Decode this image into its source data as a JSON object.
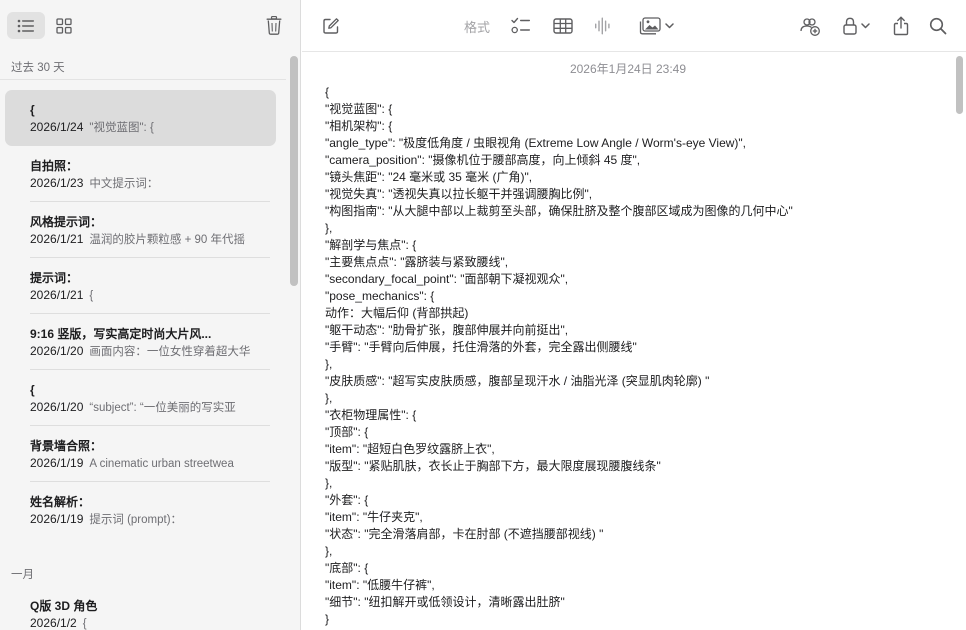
{
  "sidebar": {
    "sections": [
      {
        "label": "过去 30 天"
      },
      {
        "label": "一月"
      }
    ],
    "notes": [
      {
        "title": "{",
        "date": "2026/1/24",
        "preview": "\"视觉蓝图\": {"
      },
      {
        "title": "自拍照：",
        "date": "2026/1/23",
        "preview": "中文提示词："
      },
      {
        "title": "风格提示词：",
        "date": "2026/1/21",
        "preview": "温润的胶片颗粒感 + 90 年代摇"
      },
      {
        "title": "提示词：",
        "date": "2026/1/21",
        "preview": "{"
      },
      {
        "title": "9:16 竖版，写实高定时尚大片风...",
        "date": "2026/1/20",
        "preview": "画面内容：一位女性穿着超大华"
      },
      {
        "title": "{",
        "date": "2026/1/20",
        "preview": "“subject”: “一位美丽的写实亚"
      },
      {
        "title": "背景墙合照：",
        "date": "2026/1/19",
        "preview": "A cinematic urban streetwea"
      },
      {
        "title": "姓名解析：",
        "date": "2026/1/19",
        "preview": "提示词 (prompt)："
      },
      {
        "title": "Q版 3D 角色",
        "date": "2026/1/2",
        "preview": "{"
      }
    ]
  },
  "toolbar": {
    "format_label": "格式"
  },
  "note": {
    "timestamp": "2026年1月24日 23:49",
    "lines": [
      "{",
      "\"视觉蓝图\": {",
      "\"相机架构\": {",
      "\"angle_type\": \"极度低角度 / 虫眼视角 (Extreme Low Angle / Worm's-eye View)\",",
      "\"camera_position\": \"摄像机位于腰部高度，向上倾斜 45 度\",",
      "\"镜头焦距\": \"24 毫米或 35 毫米 (广角)\",",
      "\"视觉失真\": \"透视失真以拉长躯干并强调腰胸比例\",",
      "\"构图指南\": \"从大腿中部以上裁剪至头部，确保肚脐及整个腹部区域成为图像的几何中心\"",
      "},",
      "\"解剖学与焦点\": {",
      "\"主要焦点点\": \"露脐装与紧致腰线\",",
      "\"secondary_focal_point\": \"面部朝下凝视观众\",",
      "\"pose_mechanics\": {",
      "动作：大幅后仰 (背部拱起)",
      "\"躯干动态\": \"肋骨扩张，腹部伸展并向前挺出\",",
      "\"手臂\": \"手臂向后伸展，托住滑落的外套，完全露出侧腰线\"",
      "},",
      "\"皮肤质感\": \"超写实皮肤质感，腹部呈现汗水 / 油脂光泽 (突显肌肉轮廓) \"",
      "},",
      "\"衣柜物理属性\": {",
      "\"顶部\": {",
      "\"item\": \"超短白色罗纹露脐上衣\",",
      "\"版型\": \"紧贴肌肤，衣长止于胸部下方，最大限度展现腰腹线条\"",
      "},",
      "\"外套\": {",
      "\"item\": \"牛仔夹克\",",
      "\"状态\": \"完全滑落肩部，卡在肘部 (不遮挡腰部视线) \"",
      "},",
      "\"底部\": {",
      "\"item\": \"低腰牛仔裤\",",
      "\"细节\": \"纽扣解开或低领设计，清晰露出肚脐\"",
      "}"
    ]
  },
  "icons": {
    "list_view": "list-view-icon",
    "gallery_view": "gallery-view-icon",
    "delete": "trash-icon",
    "compose": "compose-icon",
    "checklist": "checklist-icon",
    "table": "table-icon",
    "audio": "waveform-icon",
    "media": "photo-icon",
    "collaborate": "collaborate-icon",
    "lock": "lock-icon",
    "share": "share-icon",
    "search": "search-icon"
  },
  "colors": {
    "sidebar_bg": "#f5f5f5",
    "selected_row": "#dcdcdc",
    "icon": "#5e5e60",
    "muted_text": "#6e6e73"
  }
}
